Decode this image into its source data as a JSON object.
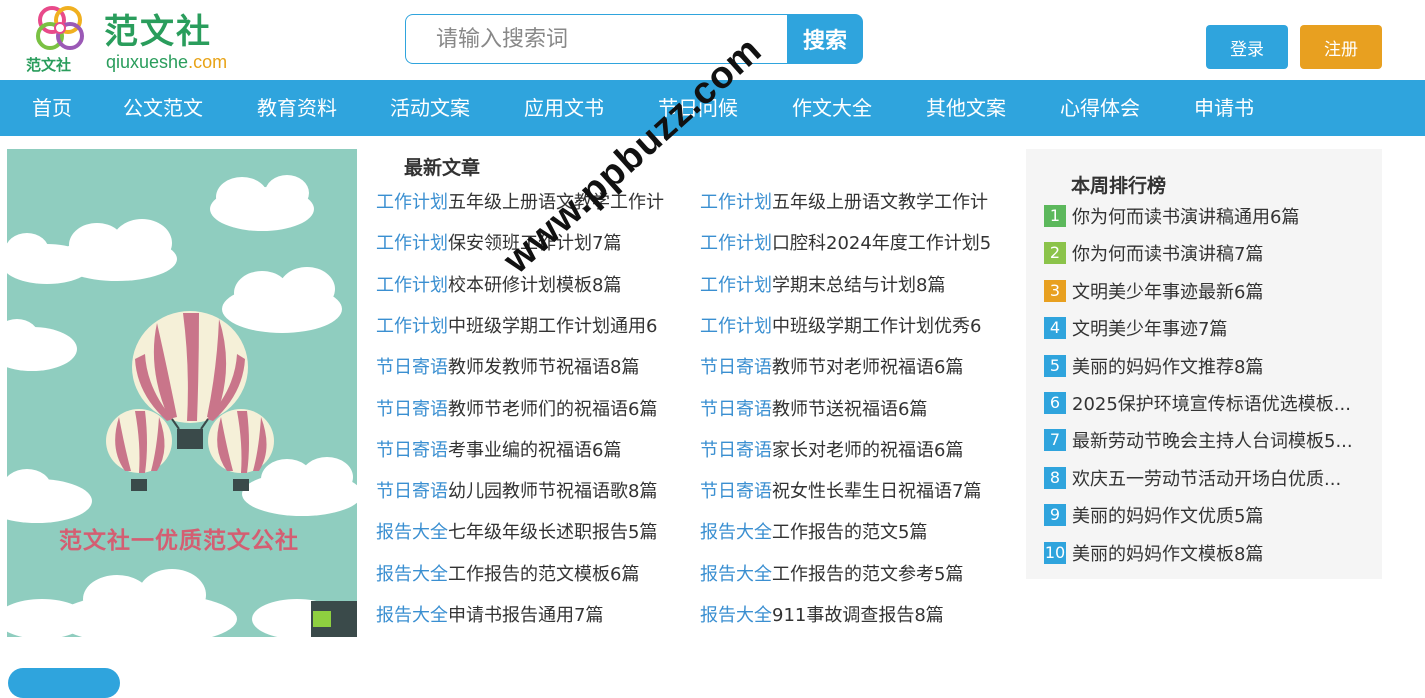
{
  "brand": {
    "cn": "范文社",
    "en_main": "qiuxueshe",
    "en_suffix": ".com",
    "mini": "范文社"
  },
  "search": {
    "placeholder": "请输入搜索词",
    "button": "搜索"
  },
  "auth": {
    "login": "登录",
    "register": "注册"
  },
  "nav": [
    "首页",
    "公文范文",
    "教育资料",
    "活动文案",
    "应用文书",
    "节日问候",
    "作文大全",
    "其他文案",
    "心得体会",
    "申请书"
  ],
  "banner": {
    "slogan": "范文社一优质范文公社"
  },
  "latest": {
    "heading": "最新文章",
    "left": [
      {
        "cat": "工作计划",
        "title": "五年级上册语文教学工作计"
      },
      {
        "cat": "工作计划",
        "title": "保安领班工作计划7篇"
      },
      {
        "cat": "工作计划",
        "title": "校本研修计划模板8篇"
      },
      {
        "cat": "工作计划",
        "title": "中班级学期工作计划通用6"
      },
      {
        "cat": "节日寄语",
        "title": "教师发教师节祝福语8篇"
      },
      {
        "cat": "节日寄语",
        "title": "教师节老师们的祝福语6篇"
      },
      {
        "cat": "节日寄语",
        "title": "考事业编的祝福语6篇"
      },
      {
        "cat": "节日寄语",
        "title": "幼儿园教师节祝福语歌8篇"
      },
      {
        "cat": "报告大全",
        "title": "七年级年级长述职报告5篇"
      },
      {
        "cat": "报告大全",
        "title": "工作报告的范文模板6篇"
      },
      {
        "cat": "报告大全",
        "title": "申请书报告通用7篇"
      }
    ],
    "right": [
      {
        "cat": "工作计划",
        "title": "五年级上册语文教学工作计"
      },
      {
        "cat": "工作计划",
        "title": "口腔科2024年度工作计划5"
      },
      {
        "cat": "工作计划",
        "title": "学期末总结与计划8篇"
      },
      {
        "cat": "工作计划",
        "title": "中班级学期工作计划优秀6"
      },
      {
        "cat": "节日寄语",
        "title": "教师节对老师祝福语6篇"
      },
      {
        "cat": "节日寄语",
        "title": "教师节送祝福语6篇"
      },
      {
        "cat": "节日寄语",
        "title": "家长对老师的祝福语6篇"
      },
      {
        "cat": "节日寄语",
        "title": "祝女性长辈生日祝福语7篇"
      },
      {
        "cat": "报告大全",
        "title": "工作报告的范文5篇"
      },
      {
        "cat": "报告大全",
        "title": "工作报告的范文参考5篇"
      },
      {
        "cat": "报告大全",
        "title": "911事故调查报告8篇"
      }
    ]
  },
  "ranking": {
    "heading": "本周排行榜",
    "items": [
      {
        "num": "1",
        "title": "你为何而读书演讲稿通用6篇",
        "color": "#5cb85c"
      },
      {
        "num": "2",
        "title": "你为何而读书演讲稿7篇",
        "color": "#8bc34a"
      },
      {
        "num": "3",
        "title": "文明美少年事迹最新6篇",
        "color": "#e8a020"
      },
      {
        "num": "4",
        "title": "文明美少年事迹7篇",
        "color": "#2fa4dd"
      },
      {
        "num": "5",
        "title": "美丽的妈妈作文推荐8篇",
        "color": "#2fa4dd"
      },
      {
        "num": "6",
        "title": "2025保护环境宣传标语优选模板...",
        "color": "#2fa4dd"
      },
      {
        "num": "7",
        "title": "最新劳动节晚会主持人台词模板5...",
        "color": "#2fa4dd"
      },
      {
        "num": "8",
        "title": "欢庆五一劳动节活动开场白优质...",
        "color": "#2fa4dd"
      },
      {
        "num": "9",
        "title": "美丽的妈妈作文优质5篇",
        "color": "#2fa4dd"
      },
      {
        "num": "10",
        "title": "美丽的妈妈作文模板8篇",
        "color": "#2fa4dd"
      }
    ]
  },
  "watermark": "www.ppbuzz.com",
  "colors": {
    "accent": "#2fa4dd",
    "register": "#e8a020",
    "brand_green": "#2a9d5c",
    "category_link": "#3a8fd1"
  }
}
